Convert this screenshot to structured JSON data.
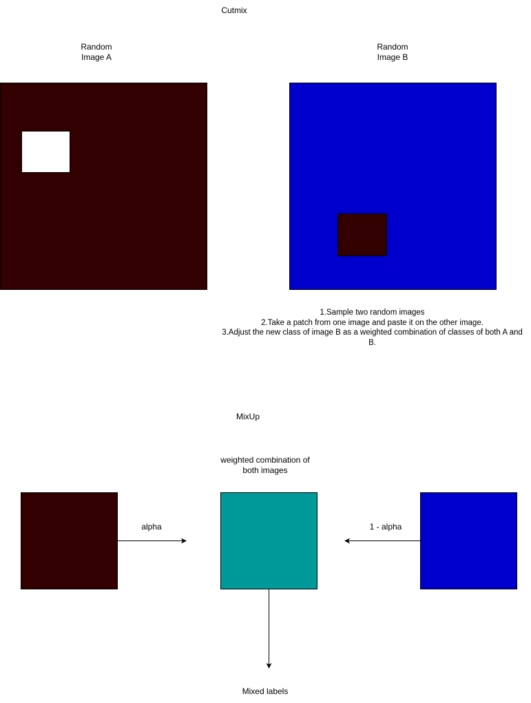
{
  "cutmix": {
    "title": "Cutmix",
    "image_a_label_line1": "Random",
    "image_a_label_line2": "Image A",
    "image_b_label_line1": "Random",
    "image_b_label_line2": "Image B",
    "steps_line1": "1.Sample two random images",
    "steps_line2": "2.Take a patch from one image and paste it on the other image.",
    "steps_line3": "3.Adjust the new class of image B as a weighted combination of classes of both A and",
    "steps_line4": "B."
  },
  "mixup": {
    "title": "MixUp",
    "combo_label_line1": "weighted combination of",
    "combo_label_line2": "both images",
    "alpha_label": "alpha",
    "one_minus_alpha_label": "1 - alpha",
    "mixed_labels": "Mixed labels"
  },
  "colors": {
    "image_a": "#330000",
    "image_b": "#0000CC",
    "patch_white": "#FFFFFF",
    "mixed": "#009999"
  }
}
